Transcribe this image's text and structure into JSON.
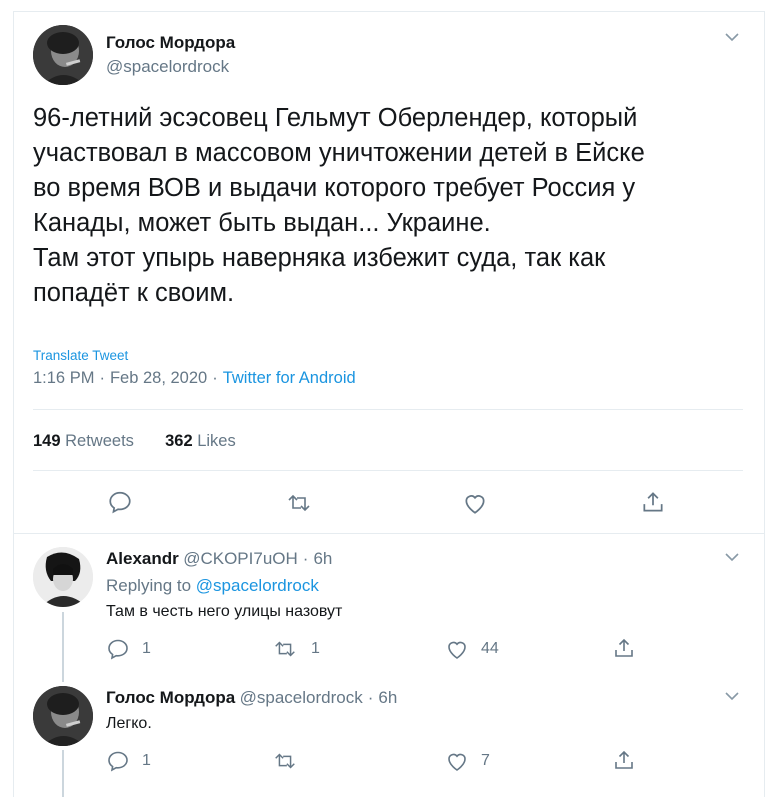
{
  "main_tweet": {
    "author_name": "Голос Мордора",
    "author_handle": "@spacelordrock",
    "text_lines": [
      "96-летний эсэсовец Гельмут Оберлендер, который",
      "участвовал в массовом уничтожении детей в Ейске",
      "во время ВОВ и выдачи которого требует Россия у",
      "Канады, может быть выдан... Украине.",
      "Там этот упырь наверняка избежит суда, так как",
      "попадёт к своим."
    ],
    "translate_label": "Translate Tweet",
    "time": "1:16 PM",
    "date": "Feb 28, 2020",
    "source": "Twitter for Android",
    "retweets_count": "149",
    "retweets_label": "Retweets",
    "likes_count": "362",
    "likes_label": "Likes",
    "icons": [
      "reply-icon",
      "retweet-icon",
      "like-icon",
      "share-icon",
      "chevron-down-icon"
    ]
  },
  "replies": [
    {
      "author_name": "Alexandr",
      "author_handle": "@CKOPI7uOH",
      "age": "6h",
      "replying_prefix": "Replying to",
      "replying_to": "@spacelordrock",
      "text": "Там в честь него улицы назовут",
      "reply_count": "1",
      "retweet_count": "1",
      "like_count": "44"
    },
    {
      "author_name": "Голос Мордора",
      "author_handle": "@spacelordrock",
      "age": "6h",
      "text": "Легко.",
      "reply_count": "1",
      "retweet_count": "",
      "like_count": "7"
    }
  ],
  "separator": "·",
  "colors": {
    "link": "#1b95e0",
    "muted": "#657786",
    "text": "#14171a",
    "border": "#e6ecf0",
    "thread_line": "#ccd6dd"
  }
}
